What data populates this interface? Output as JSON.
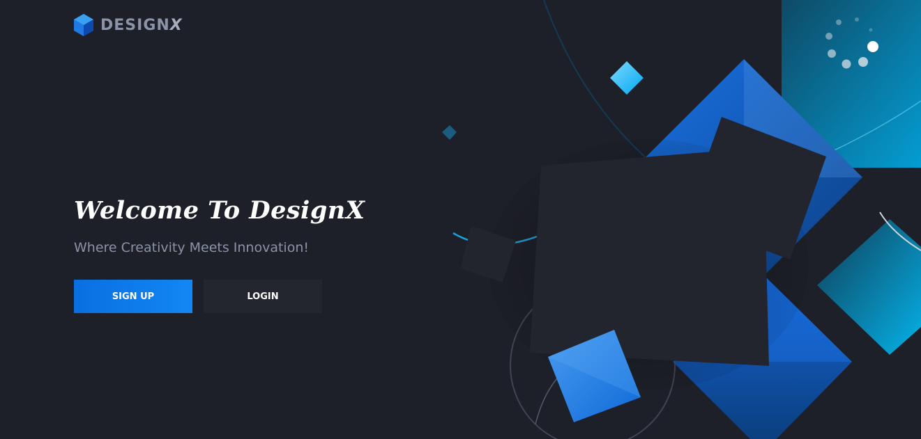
{
  "brand": {
    "name_main": "DESIGN",
    "name_accent": "X",
    "logo_icon": "hexagon-cube-icon"
  },
  "hero": {
    "title": "Welcome To DesignX",
    "subtitle": "Where Creativity Meets Innovation!"
  },
  "actions": {
    "signup_label": "SIGN UP",
    "login_label": "LOGIN"
  },
  "colors": {
    "background": "#1e2029",
    "primary_blue": "#0a6fe0",
    "accent_cyan": "#1aa8d6",
    "dark_panel": "#23262f",
    "muted_text": "#8c93a6"
  }
}
